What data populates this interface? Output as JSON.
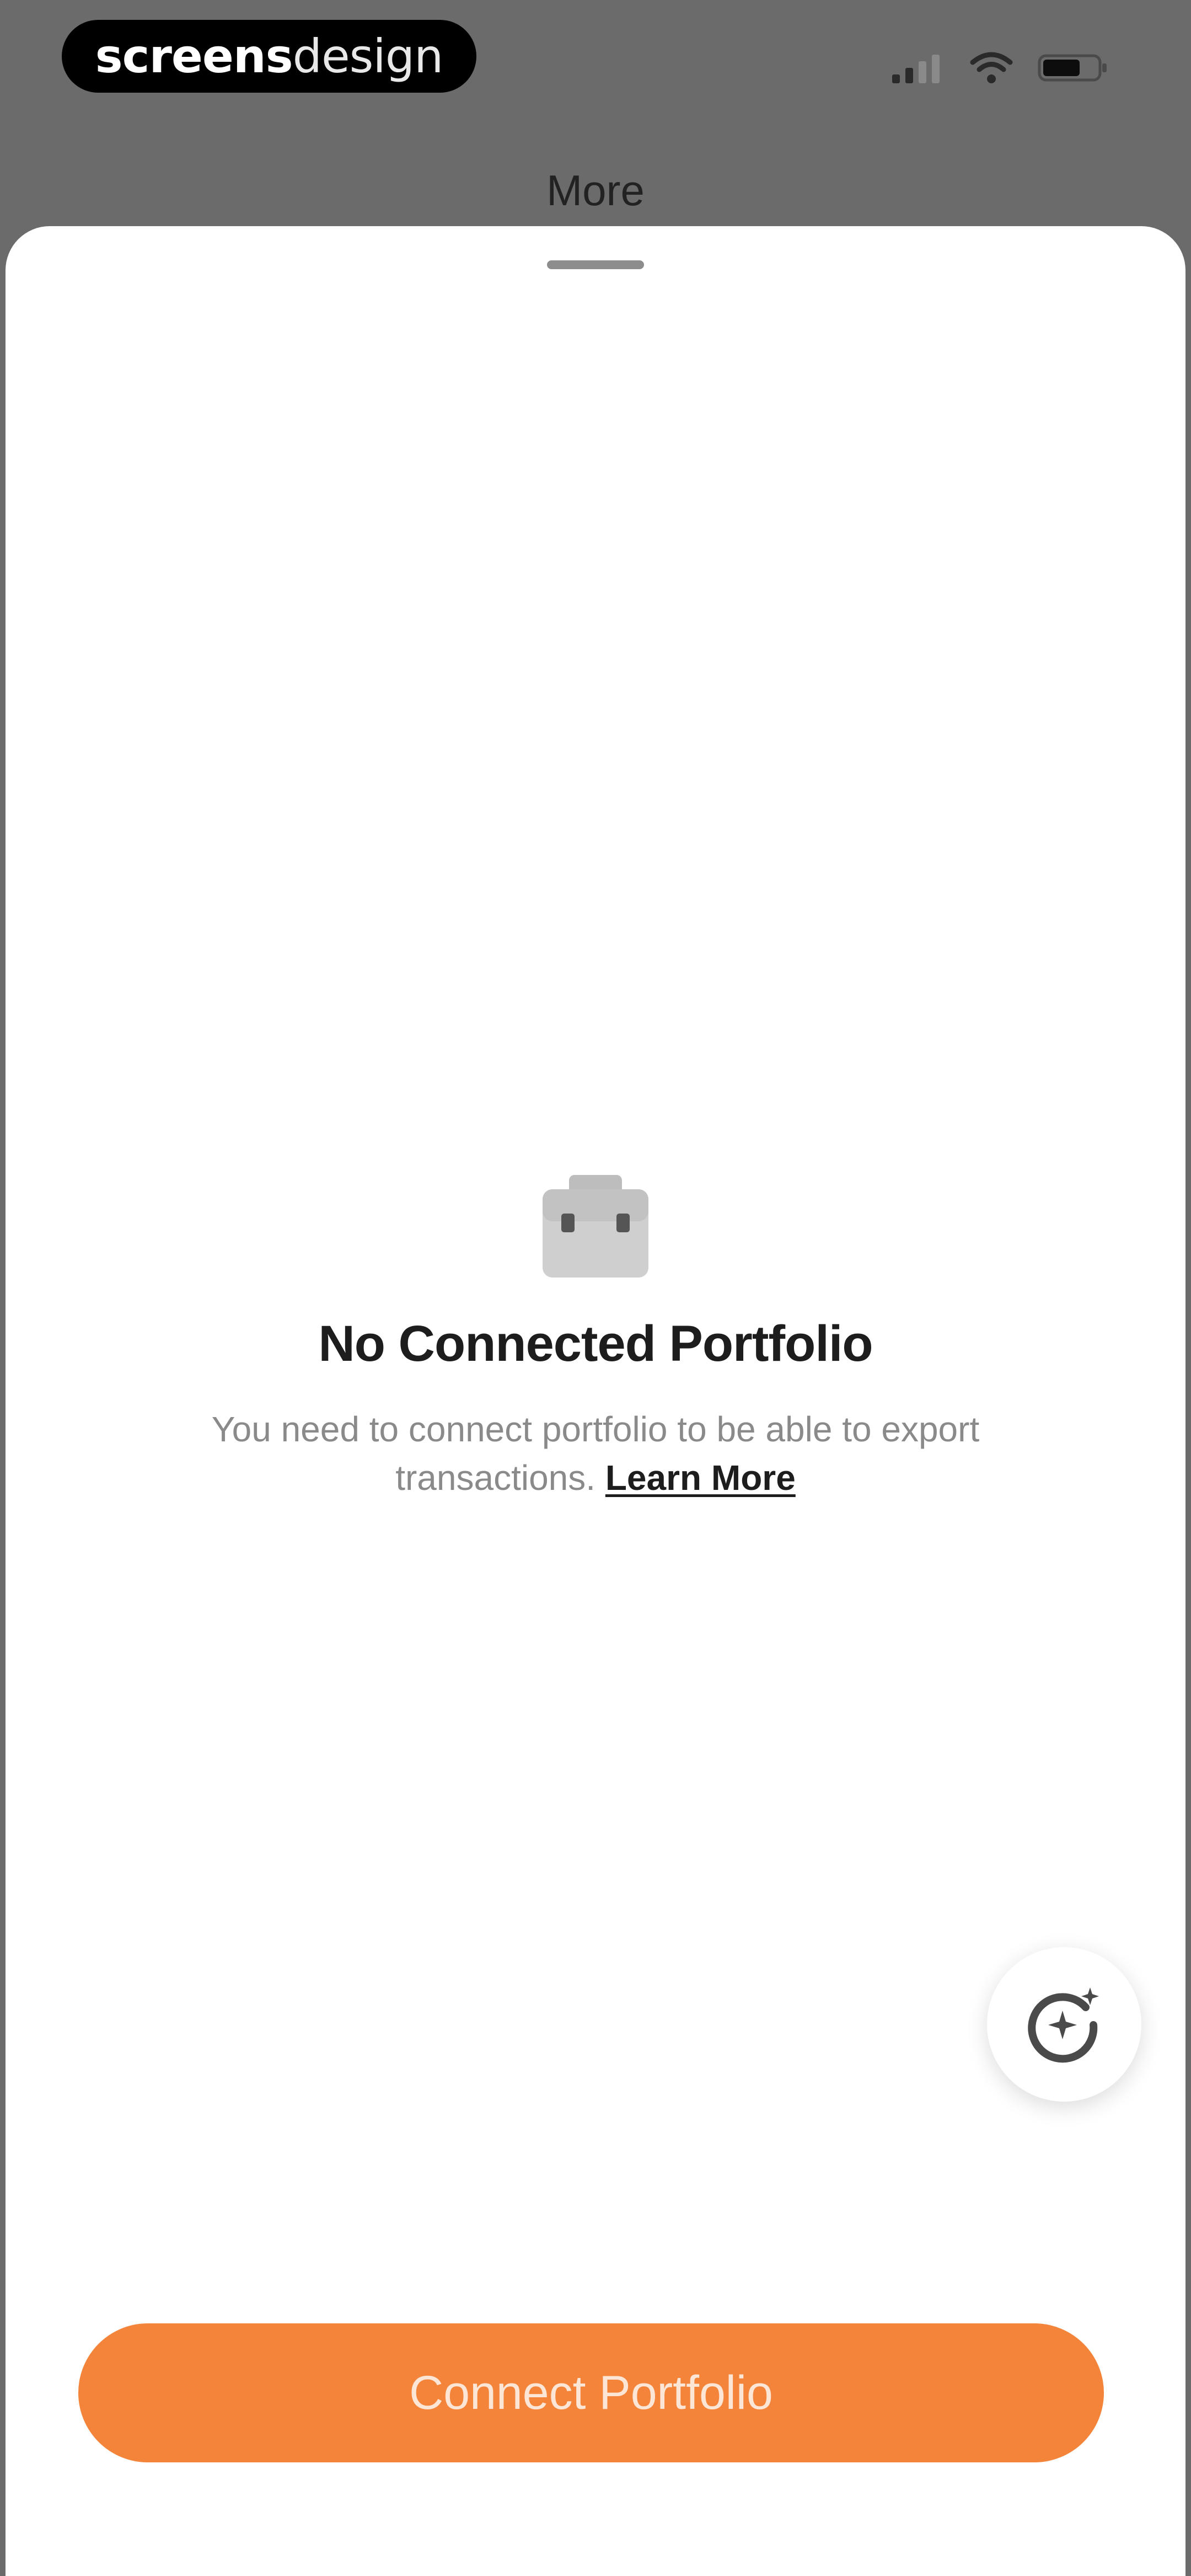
{
  "status_bar": {
    "brand_bold": "screens",
    "brand_light": "design",
    "icons": [
      "cellular-signal-icon",
      "wifi-icon",
      "battery-icon"
    ]
  },
  "nav": {
    "title": "More"
  },
  "empty_state": {
    "icon": "briefcase-icon",
    "title": "No Connected Portfolio",
    "body": "You need to connect portfolio to be able to export transactions.",
    "link": "Learn More"
  },
  "fab": {
    "icon": "ai-sparkle-icon"
  },
  "cta": {
    "label": "Connect Portfolio",
    "color": "#f4843a"
  }
}
